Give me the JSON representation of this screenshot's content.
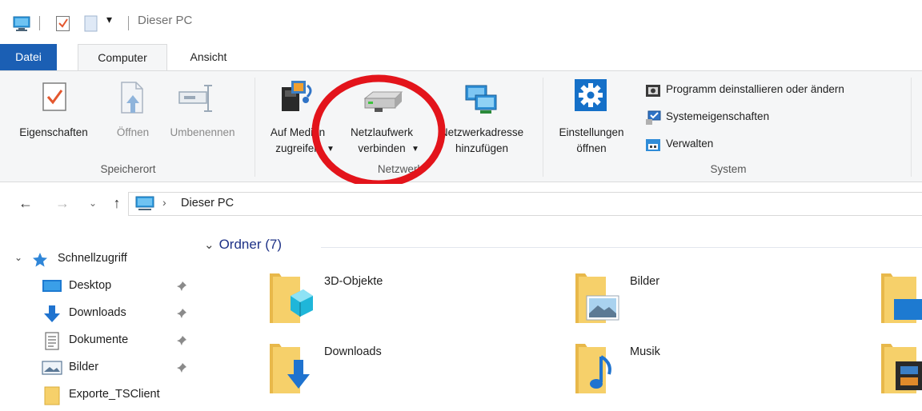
{
  "window": {
    "title": "Dieser PC"
  },
  "tabs": [
    {
      "label": "Datei"
    },
    {
      "label": "Computer"
    },
    {
      "label": "Ansicht"
    }
  ],
  "ribbon": {
    "groups": {
      "speicherort": "Speicherort",
      "netzwerk": "Netzwerk",
      "system": "System"
    },
    "eigenschaften": "Eigenschaften",
    "oeffnen": "Öffnen",
    "umbenennen": "Umbenennen",
    "medien_line1": "Auf Medien",
    "medien_line2": "zugreifen",
    "netzlaufwerk_line1": "Netzlaufwerk",
    "netzlaufwerk_line2": "verbinden",
    "netzwerkadresse_line1": "Netzwerkadresse",
    "netzwerkadresse_line2": "hinzufügen",
    "einstellungen_line1": "Einstellungen",
    "einstellungen_line2": "öffnen",
    "programm": "Programm deinstallieren oder ändern",
    "systemeigenschaften": "Systemeigenschaften",
    "verwalten": "Verwalten"
  },
  "address": {
    "path": "Dieser PC"
  },
  "nav": {
    "quick_access": "Schnellzugriff",
    "items": [
      {
        "label": "Desktop"
      },
      {
        "label": "Downloads"
      },
      {
        "label": "Dokumente"
      },
      {
        "label": "Bilder"
      },
      {
        "label": "Exporte_TSClient"
      }
    ]
  },
  "content": {
    "group_title": "Ordner (7)",
    "folders": [
      {
        "label": "3D-Objekte"
      },
      {
        "label": "Bilder"
      },
      {
        "label": "Downloads"
      },
      {
        "label": "Musik"
      }
    ]
  },
  "colors": {
    "accent": "#1b5fb4",
    "annotation": "#e3141b",
    "folder": "#f6d06a"
  }
}
